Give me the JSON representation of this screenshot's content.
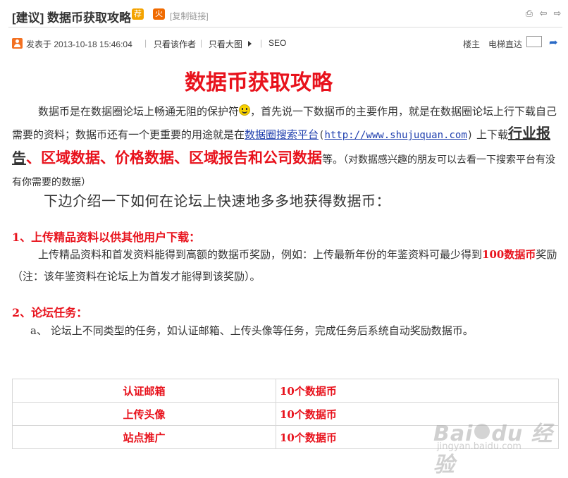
{
  "header": {
    "title": "[建议] 数据币获取攻略",
    "badge_recommend": "荐",
    "badge_hot": "火",
    "copy_link": "[复制链接]",
    "icons": [
      "print-icon",
      "prev-thread-icon",
      "next-thread-icon"
    ]
  },
  "meta": {
    "posted": "发表于 2013-10-18 15:46:04",
    "separator": "|",
    "only_author": "只看该作者",
    "only_big_image": "只看大图",
    "seo": "SEO",
    "floor_owner": "楼主",
    "elevator": "电梯直达",
    "floor_value": ""
  },
  "post": {
    "heading": "数据币获取攻略",
    "p1_a": "数据币是在数据圈论坛上畅通无阻的保护符",
    "p1_b": "，首先说一下数据币的主要作用，就是在数据圈论坛上行下载自己需要的资料；数据币还有一个更重要的用途就是在",
    "p1_link": "数据圈搜索平台",
    "p1_paren_open": "(",
    "p1_url": "http://www.shujuquan.com",
    "p1_paren_close": ")",
    "p1_c": " 上下载",
    "p1_industry": "行业报告",
    "p1_red": "、区域数据、价格数据、区域报告和公司数据",
    "p1_d": "等。",
    "p1_note": "（对数据感兴趣的朋友可以去看一下搜索平台有没有你需要的数据）",
    "intro": "下边介绍一下如何在论坛上快速地多多地获得数据币：",
    "sec1_title": "1、上传精品资料以供其他用户下载：",
    "sec1_a": "上传精品资料和首发资料能得到高额的数据币奖励，例如：上传最新年份的年鉴资料可最少得到",
    "sec1_red": "100数据币",
    "sec1_b": "奖励（注：该年鉴资料在论坛上为首发才能得到该奖励）。",
    "sec2_title": "2、论坛任务：",
    "sec2_a": "a、  论坛上不同类型的任务，如认证邮箱、上传头像等任务，完成任务后系统自动奖励数据币。"
  },
  "reward_table": [
    [
      "认证邮箱",
      "10个数据币"
    ],
    [
      "上传头像",
      "10个数据币"
    ],
    [
      "站点推广",
      "10个数据币"
    ]
  ],
  "watermark": {
    "logo_left": "Bai",
    "logo_right": "du 经验",
    "sub": "jingyan.baidu.com"
  },
  "colors": {
    "accent_red": "#e8121c",
    "link_blue": "#1f3fae",
    "badge_orange": "#f4a300"
  }
}
